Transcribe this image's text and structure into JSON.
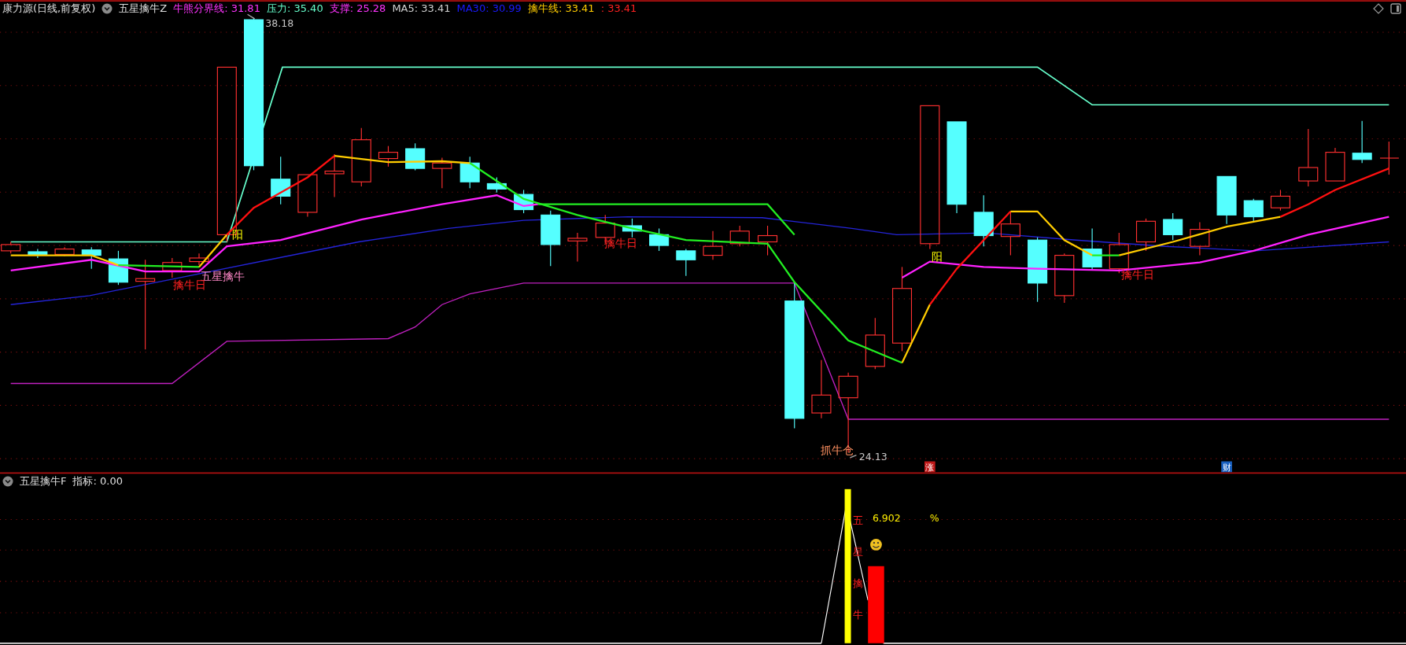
{
  "header": {
    "title": "康力源(日线,前复权)",
    "indicator": "五星擒牛Z",
    "legend": [
      {
        "text": "牛熊分界线: 31.81",
        "color": "#ff33ff"
      },
      {
        "text": "压力: 35.40",
        "color": "#66ffcc"
      },
      {
        "text": "支撑: 25.28",
        "color": "#ff33ff"
      },
      {
        "text": "MA5: 33.41",
        "color": "#d0d0d0"
      },
      {
        "text": "MA30: 30.99",
        "color": "#1a1aff"
      },
      {
        "text": "擒牛线: 33.41",
        "color": "#ffcc00"
      },
      {
        "text": ": 33.41",
        "color": "#ff2020"
      }
    ]
  },
  "main_chart": {
    "price_labels": [
      {
        "kind": "high",
        "text": "38.18"
      },
      {
        "kind": "low",
        "text": "24.13"
      }
    ],
    "annotations": [
      {
        "text": "阳",
        "color": "#ffff00"
      },
      {
        "text": "五星擒牛",
        "color": "#ff88c8"
      },
      {
        "text": "擒牛日",
        "color": "#ff2020"
      },
      {
        "text": "擒牛日",
        "color": "#ff2020"
      },
      {
        "text": "阳",
        "color": "#ffff00"
      },
      {
        "text": "擒牛日",
        "color": "#ff2020"
      },
      {
        "text": "抓牛仓",
        "color": "#ff9060"
      }
    ],
    "event_markers": [
      {
        "text": "涨",
        "color": "#c01818"
      },
      {
        "text": "财",
        "color": "#1860c0"
      }
    ]
  },
  "lower_panel": {
    "title": "五星擒牛F",
    "reading": "指标: 0.00",
    "value": "6.902",
    "unit": "%",
    "vertical_label": "五星擒牛"
  }
}
